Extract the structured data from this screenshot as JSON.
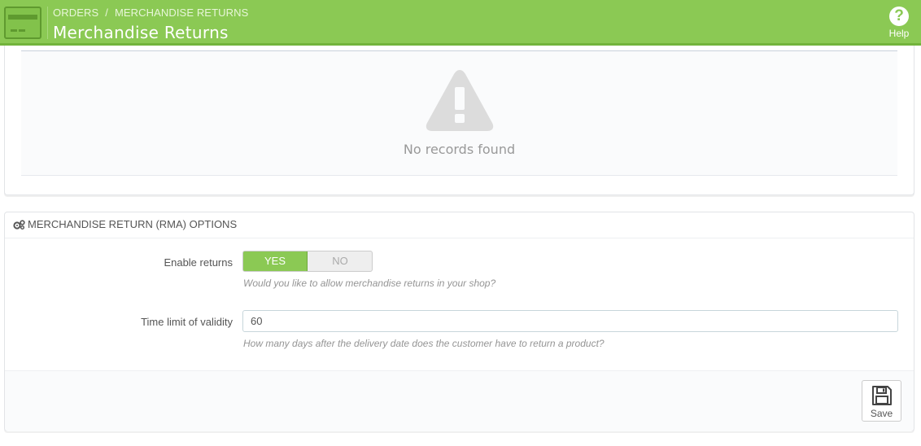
{
  "header": {
    "breadcrumb": [
      "ORDERS",
      "MERCHANDISE RETURNS"
    ],
    "breadcrumb_separator": "/",
    "title": "Merchandise Returns",
    "help_label": "Help",
    "help_glyph": "?",
    "accent_color": "#8bc954"
  },
  "list": {
    "empty_message": "No records found",
    "empty_icon": "warning-icon"
  },
  "options": {
    "heading": "MERCHANDISE RETURN (RMA) OPTIONS",
    "heading_icon": "gears-icon",
    "enable_returns": {
      "label": "Enable returns",
      "yes_label": "YES",
      "no_label": "NO",
      "selected": "YES",
      "help": "Would you like to allow merchandise returns in your shop?"
    },
    "time_limit": {
      "label": "Time limit of validity",
      "value": "60",
      "help": "How many days after the delivery date does the customer have to return a product?"
    },
    "save_label": "Save",
    "save_icon": "floppy-disk-icon"
  }
}
